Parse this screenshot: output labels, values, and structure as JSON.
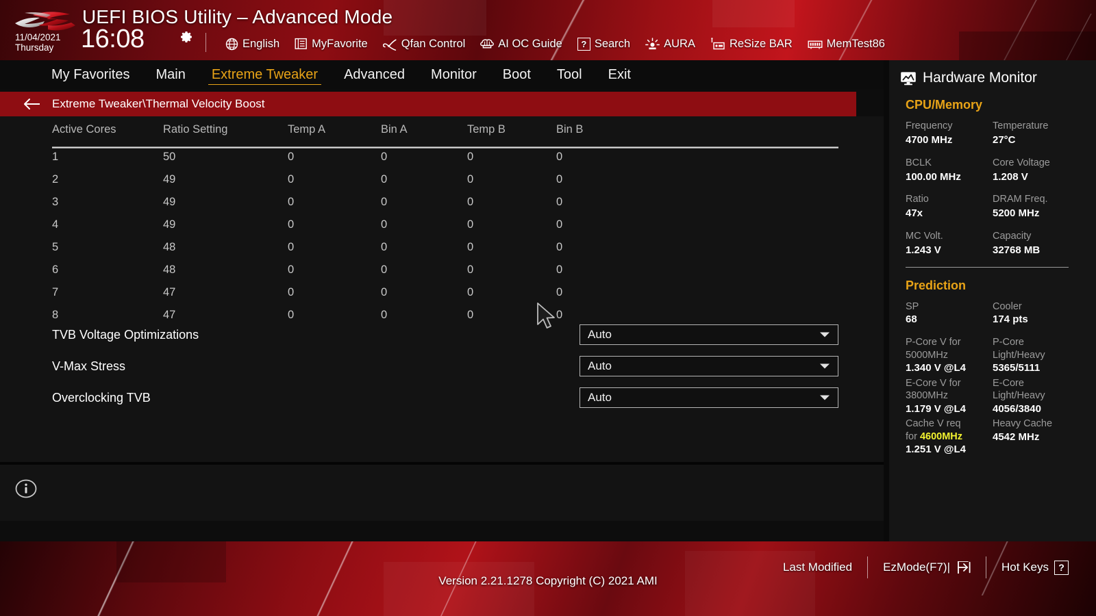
{
  "header": {
    "logo_name": "rog-logo",
    "title": "UEFI BIOS Utility – Advanced Mode",
    "date": "11/04/2021",
    "weekday": "Thursday",
    "time": "16:08",
    "gear_icon": "gear-icon",
    "tools": [
      {
        "id": "language",
        "icon": "globe-icon",
        "label": "English"
      },
      {
        "id": "myfavorite",
        "icon": "list-icon",
        "label": "MyFavorite"
      },
      {
        "id": "qfan",
        "icon": "fan-icon",
        "label": "Qfan Control"
      },
      {
        "id": "aioc",
        "icon": "brain-icon",
        "label": "AI OC Guide"
      },
      {
        "id": "search",
        "icon": "question-box-icon",
        "label": "Search"
      },
      {
        "id": "aura",
        "icon": "lamp-icon",
        "label": "AURA"
      },
      {
        "id": "resizebar",
        "icon": "resizebar-icon",
        "label": "ReSize BAR"
      },
      {
        "id": "memtest",
        "icon": "memory-icon",
        "label": "MemTest86"
      }
    ]
  },
  "nav": {
    "tabs": [
      {
        "label": "My Favorites",
        "active": false
      },
      {
        "label": "Main",
        "active": false
      },
      {
        "label": "Extreme Tweaker",
        "active": true
      },
      {
        "label": "Advanced",
        "active": false
      },
      {
        "label": "Monitor",
        "active": false
      },
      {
        "label": "Boot",
        "active": false
      },
      {
        "label": "Tool",
        "active": false
      },
      {
        "label": "Exit",
        "active": false
      }
    ]
  },
  "breadcrumb": {
    "back_icon": "back-arrow-icon",
    "path": "Extreme Tweaker\\Thermal Velocity Boost"
  },
  "table": {
    "columns": [
      "Active Cores",
      "Ratio Setting",
      "Temp A",
      "Bin A",
      "Temp B",
      "Bin B"
    ],
    "rows": [
      [
        "1",
        "50",
        "0",
        "0",
        "0",
        "0"
      ],
      [
        "2",
        "49",
        "0",
        "0",
        "0",
        "0"
      ],
      [
        "3",
        "49",
        "0",
        "0",
        "0",
        "0"
      ],
      [
        "4",
        "49",
        "0",
        "0",
        "0",
        "0"
      ],
      [
        "5",
        "48",
        "0",
        "0",
        "0",
        "0"
      ],
      [
        "6",
        "48",
        "0",
        "0",
        "0",
        "0"
      ],
      [
        "7",
        "47",
        "0",
        "0",
        "0",
        "0"
      ],
      [
        "8",
        "47",
        "0",
        "0",
        "0",
        "0"
      ]
    ]
  },
  "settings": [
    {
      "label": "TVB Voltage Optimizations",
      "value": "Auto"
    },
    {
      "label": "V-Max Stress",
      "value": "Auto"
    },
    {
      "label": "Overclocking TVB",
      "value": "Auto"
    }
  ],
  "info_icon": "info-icon",
  "hardware_monitor": {
    "icon": "monitor-icon",
    "title": "Hardware Monitor",
    "cpu_memory": {
      "section": "CPU/Memory",
      "pairs": [
        [
          {
            "label": "Frequency",
            "value": "4700 MHz"
          },
          {
            "label": "Temperature",
            "value": "27°C"
          }
        ],
        [
          {
            "label": "BCLK",
            "value": "100.00 MHz"
          },
          {
            "label": "Core Voltage",
            "value": "1.208 V"
          }
        ],
        [
          {
            "label": "Ratio",
            "value": "47x"
          },
          {
            "label": "DRAM Freq.",
            "value": "5200 MHz"
          }
        ],
        [
          {
            "label": "MC Volt.",
            "value": "1.243 V"
          },
          {
            "label": "Capacity",
            "value": "32768 MB"
          }
        ]
      ]
    },
    "prediction": {
      "section": "Prediction",
      "sp_label": "SP",
      "sp_value": "68",
      "cooler_label": "Cooler",
      "cooler_value": "174 pts",
      "pcore_label_a": "P-Core V for",
      "pcore_freq": "5000MHz",
      "pcore_value": "1.340 V @L4",
      "pcore_lh_label_1": "P-Core",
      "pcore_lh_label_2": "Light/Heavy",
      "pcore_lh_value": "5365/5111",
      "ecore_label_a": "E-Core V for",
      "ecore_freq": "3800MHz",
      "ecore_value": "1.179 V @L4",
      "ecore_lh_label_1": "E-Core",
      "ecore_lh_label_2": "Light/Heavy",
      "ecore_lh_value": "4056/3840",
      "cache_label_a": "Cache V req",
      "cache_label_b": "for",
      "cache_freq": "4600MHz",
      "cache_value": "1.251 V @L4",
      "heavy_cache_label": "Heavy Cache",
      "heavy_cache_value": "4542 MHz"
    }
  },
  "footer": {
    "version": "Version 2.21.1278 Copyright (C) 2021 AMI",
    "last_modified": "Last Modified",
    "ezmode": "EzMode(F7)|",
    "hotkeys": "Hot Keys",
    "hotkeys_glyph": "?"
  },
  "colors": {
    "accent_gold": "#e8a317",
    "accent_yellow": "#f2f230",
    "brand_red": "#8e0d12",
    "panel_bg": "#151515",
    "content_bg": "#131313"
  }
}
